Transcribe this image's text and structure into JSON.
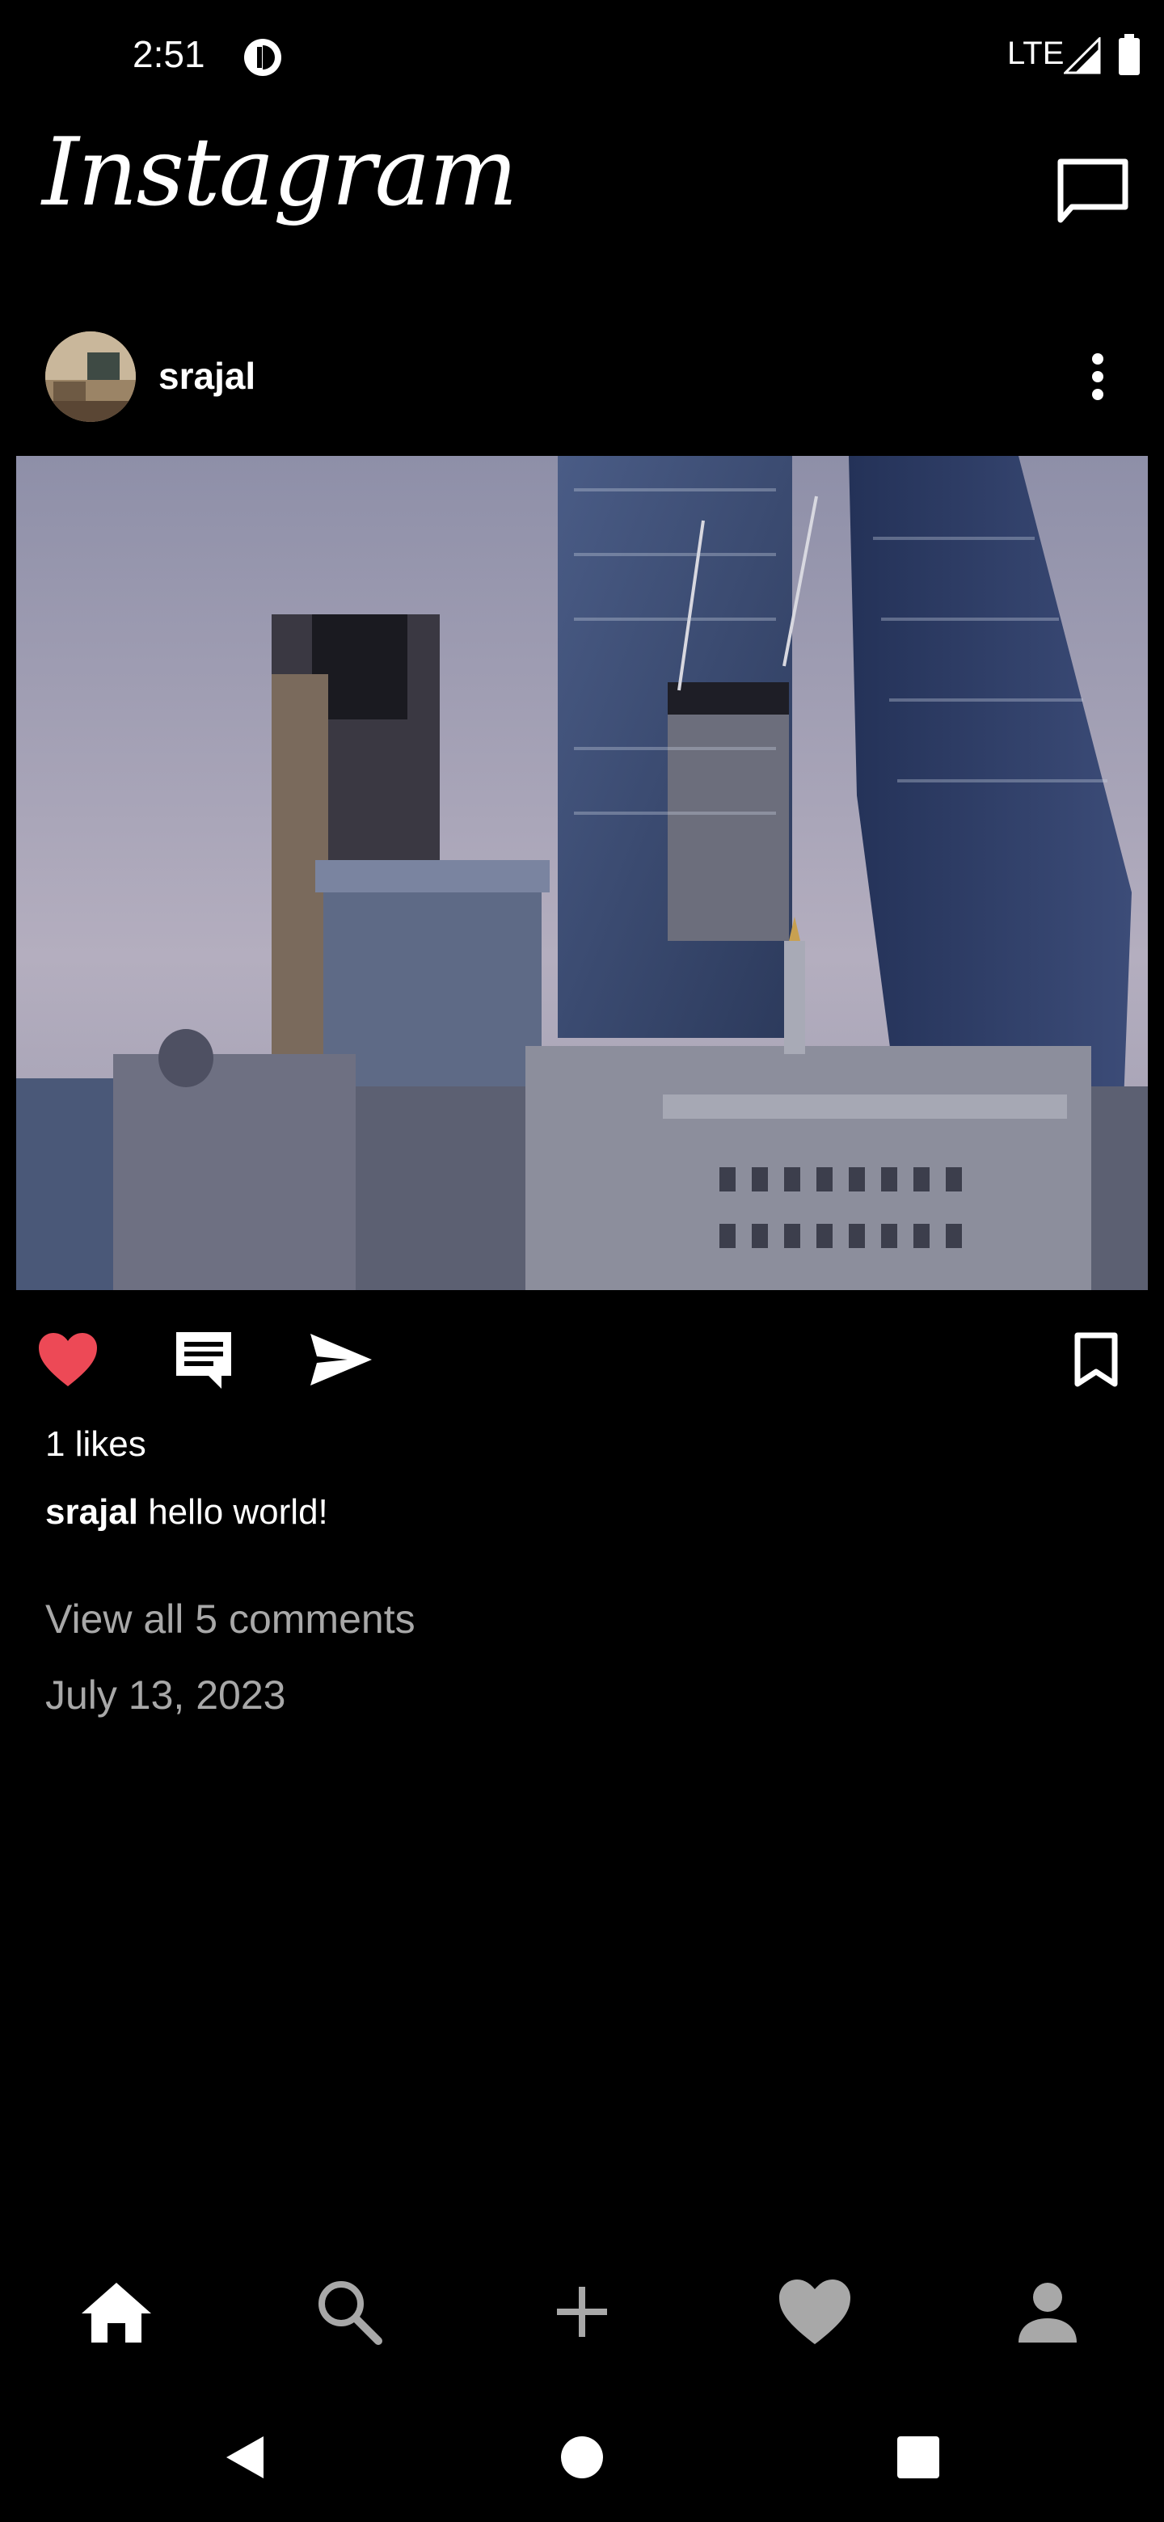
{
  "status_bar": {
    "time": "2:51",
    "network": "LTE",
    "app_icon": "pocket-casts-style-icon",
    "signal_icon": "signal-icon",
    "battery_icon": "battery-icon"
  },
  "header": {
    "brand": "Instagram",
    "messages_icon": "chat-bubble-icon"
  },
  "post": {
    "author": "srajal",
    "more_icon": "more-vertical-icon",
    "image_description_icon": "photo",
    "likes": "1 likes",
    "caption_author": "srajal",
    "caption_text": " hello world!",
    "view_comments": "View all 5 comments",
    "date": "July 13, 2023",
    "liked": true,
    "colors": {
      "like_active": "#ed4956",
      "muted_text": "#a8a8a8"
    }
  },
  "actions": {
    "like_icon": "heart-filled-icon",
    "comment_icon": "comment-icon",
    "share_icon": "send-icon",
    "save_icon": "bookmark-icon"
  },
  "bottom_nav": {
    "items": [
      {
        "name": "home",
        "icon": "home-icon"
      },
      {
        "name": "search",
        "icon": "search-icon"
      },
      {
        "name": "create",
        "icon": "plus-icon"
      },
      {
        "name": "activity",
        "icon": "heart-icon"
      },
      {
        "name": "profile",
        "icon": "person-icon"
      }
    ]
  },
  "system_nav": {
    "back_icon": "back-triangle-icon",
    "home_icon": "home-circle-icon",
    "recents_icon": "recents-square-icon"
  }
}
